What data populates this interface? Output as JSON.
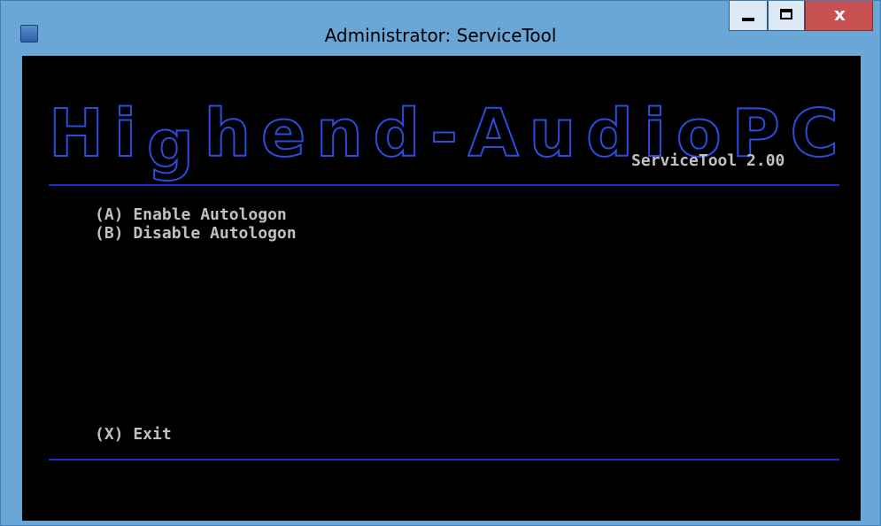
{
  "window": {
    "title": "Administrator: ServiceTool",
    "close_glyph": "x"
  },
  "banner": {
    "letters": [
      "H",
      "i",
      "g",
      "h",
      "e",
      "n",
      "d",
      "-",
      "A",
      "u",
      "d",
      "i",
      "o",
      "P",
      "C"
    ],
    "descender_letters": [
      "g"
    ],
    "version": "ServiceTool 2.00"
  },
  "menu": {
    "items": [
      {
        "key": "A",
        "label": "(A) Enable Autologon"
      },
      {
        "key": "B",
        "label": "(B) Disable Autologon"
      },
      {
        "key": "X",
        "label": "(X) Exit"
      }
    ]
  },
  "colors": {
    "titlebar": "#6aa6d6",
    "console_bg": "#000000",
    "console_text": "#c0c0c0",
    "banner_blue": "#2a4de0",
    "rule_blue": "#1a2fc8",
    "close_button": "#c75050"
  },
  "icons": {
    "app": "powershell-icon",
    "minimize": "minimize-icon",
    "maximize": "maximize-icon",
    "close": "close-icon"
  }
}
